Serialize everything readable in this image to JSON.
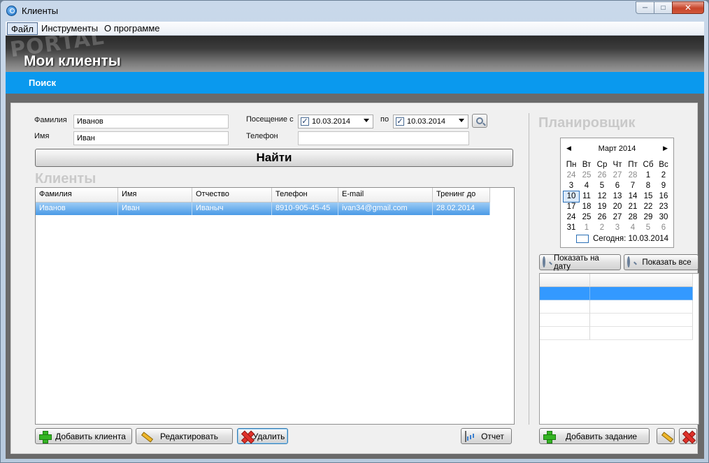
{
  "window": {
    "title": "Клиенты"
  },
  "menu": {
    "items": [
      "Файл",
      "Инструменты",
      "О программе"
    ]
  },
  "watermark": "PORTAL",
  "header": {
    "title": "Мои клиенты"
  },
  "tabs": {
    "search": "Поиск"
  },
  "form": {
    "lastname_label": "Фамилия",
    "lastname_value": "Иванов",
    "firstname_label": "Имя",
    "firstname_value": "Иван",
    "visit_from_label": "Посещение с",
    "visit_from_value": "10.03.2014",
    "visit_to_label": "по",
    "visit_to_value": "10.03.2014",
    "phone_label": "Телефон",
    "phone_value": "",
    "find_button": "Найти"
  },
  "clients": {
    "title": "Клиенты",
    "columns": [
      "Фамилия",
      "Имя",
      "Отчество",
      "Телефон",
      "E-mail",
      "Тренинг до"
    ],
    "rows": [
      [
        "Иванов",
        "Иван",
        "Иваныч",
        "8910-905-45-45",
        "ivan34@gmail.com",
        "28.02.2014"
      ]
    ]
  },
  "actions": {
    "add_client": "Добавить клиента",
    "edit": "Редактировать",
    "delete": "Удалить",
    "report": "Отчет"
  },
  "planner": {
    "title": "Планировщик",
    "calendar": {
      "month": "Март 2014",
      "weekdays": [
        "Пн",
        "Вт",
        "Ср",
        "Чт",
        "Пт",
        "Сб",
        "Вс"
      ],
      "weeks": [
        [
          "24",
          "25",
          "26",
          "27",
          "28",
          "1",
          "2"
        ],
        [
          "3",
          "4",
          "5",
          "6",
          "7",
          "8",
          "9"
        ],
        [
          "10",
          "11",
          "12",
          "13",
          "14",
          "15",
          "16"
        ],
        [
          "17",
          "18",
          "19",
          "20",
          "21",
          "22",
          "23"
        ],
        [
          "24",
          "25",
          "26",
          "27",
          "28",
          "29",
          "30"
        ],
        [
          "31",
          "1",
          "2",
          "3",
          "4",
          "5",
          "6"
        ]
      ],
      "today_label": "Сегодня: 10.03.2014"
    },
    "show_on_date": "Показать на дату",
    "show_all": "Показать все",
    "add_task": "Добавить задание"
  }
}
